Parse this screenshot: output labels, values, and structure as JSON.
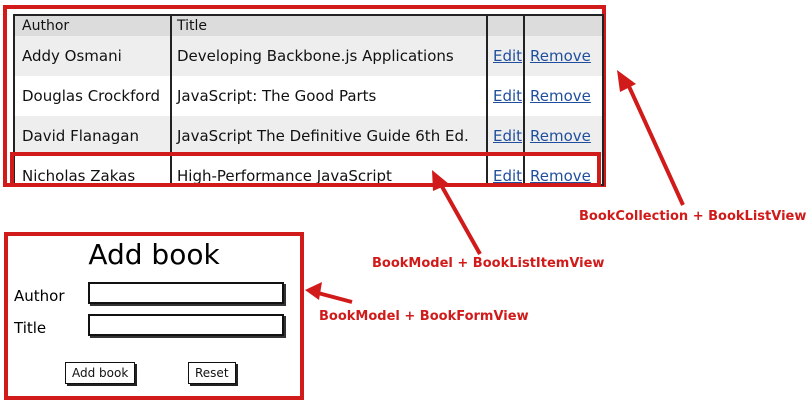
{
  "table": {
    "headers": {
      "author": "Author",
      "title": "Title"
    },
    "rows": [
      {
        "author": "Addy Osmani",
        "title": "Developing Backbone.js Applications",
        "edit": "Edit",
        "remove": "Remove"
      },
      {
        "author": "Douglas Crockford",
        "title": "JavaScript: The Good Parts",
        "edit": "Edit",
        "remove": "Remove"
      },
      {
        "author": "David Flanagan",
        "title": "JavaScript The Definitive Guide 6th Ed.",
        "edit": "Edit",
        "remove": "Remove"
      },
      {
        "author": "Nicholas Zakas",
        "title": "High-Performance JavaScript",
        "edit": "Edit",
        "remove": "Remove"
      }
    ]
  },
  "form": {
    "title": "Add book",
    "author_label": "Author",
    "title_label": "Title",
    "author_value": "",
    "title_value": "",
    "add_button": "Add book",
    "reset_button": "Reset"
  },
  "annotations": {
    "collection": "BookCollection + BookListView",
    "item": "BookModel + BookListItemView",
    "form": "BookModel + BookFormView"
  },
  "colors": {
    "annotation_red": "#d11a1a",
    "link_blue": "#1f4f9c",
    "header_bg": "#dcdcdc",
    "alt_row_bg": "#eeeeee"
  }
}
